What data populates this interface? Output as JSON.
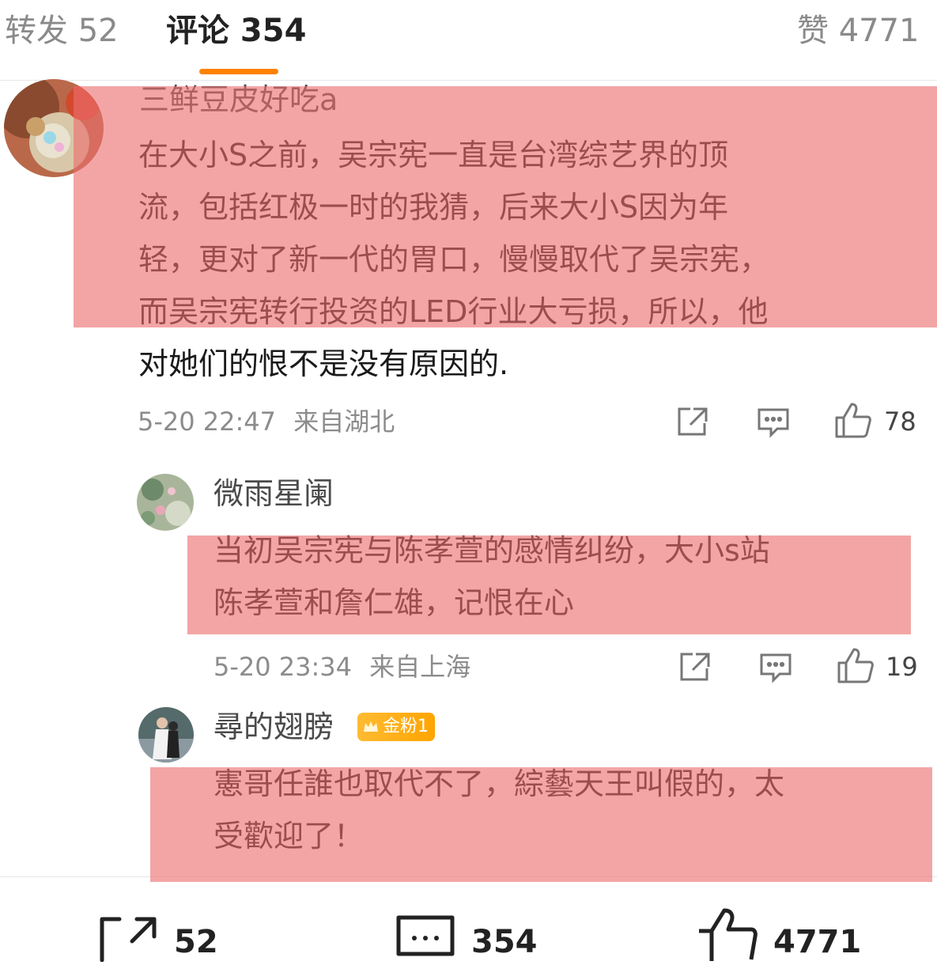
{
  "tabs": {
    "reposts": "转发 52",
    "comments": "评论 354",
    "likes": "赞 4771"
  },
  "comments": [
    {
      "username": "三鲜豆皮好吃a",
      "lines": [
        "在大小S之前，吴宗宪一直是台湾综艺界的顶",
        "流，包括红极一时的我猜，后来大小S因为年",
        "轻，更对了新一代的胃口，慢慢取代了吴宗宪，",
        "而吴宗宪转行投资的LED行业大亏损，所以，他",
        "对她们的恨不是没有原因的."
      ],
      "time": "5-20 22:47",
      "location": "来自湖北",
      "likes": "78"
    },
    {
      "username": "微雨星阑",
      "lines": [
        "当初吴宗宪与陈孝萱的感情纠纷，大小s站",
        "陈孝萱和詹仁雄，记恨在心"
      ],
      "time": "5-20 23:34",
      "location": "来自上海",
      "likes": "19"
    },
    {
      "username": "尋的翅膀",
      "badge": "金粉1",
      "lines": [
        "憲哥任誰也取代不了，綜藝天王叫假的，太",
        "受歡迎了！"
      ]
    }
  ],
  "bottom_bar": {
    "repost_count": "52",
    "comment_count": "354",
    "like_count": "4771"
  },
  "colors": {
    "accent": "#ff8200",
    "highlight": "#ec6e6e",
    "badge": "#ffa500"
  },
  "icons": [
    "share-icon",
    "comment-icon",
    "thumbs-up-icon",
    "repost-icon"
  ]
}
